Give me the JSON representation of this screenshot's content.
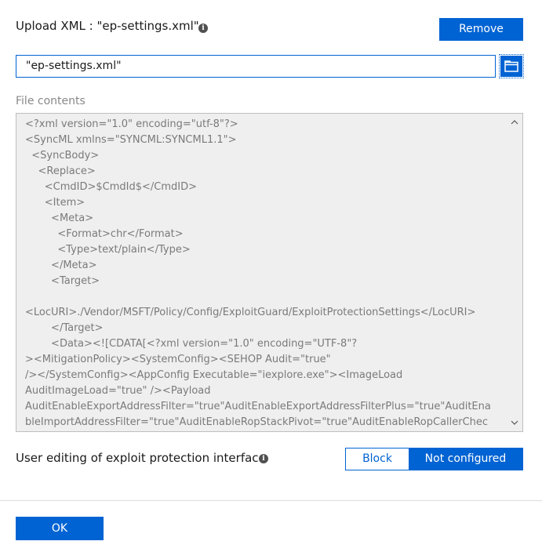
{
  "upload": {
    "label": "Upload XML : \"ep-settings.xml\"",
    "remove_label": "Remove",
    "file_value": "\"ep-settings.xml\""
  },
  "file_contents": {
    "label": "File contents",
    "text": "<?xml version=\"1.0\" encoding=\"utf-8\"?>\n<SyncML xmlns=\"SYNCML:SYNCML1.1\">\n  <SyncBody>\n    <Replace>\n      <CmdID>$CmdId$</CmdID>\n      <Item>\n        <Meta>\n          <Format>chr</Format>\n          <Type>text/plain</Type>\n        </Meta>\n        <Target>\n\n<LocURI>./Vendor/MSFT/Policy/Config/ExploitGuard/ExploitProtectionSettings</LocURI>\n        </Target>\n        <Data><![CDATA[<?xml version=\"1.0\" encoding=\"UTF-8\"?\n><MitigationPolicy><SystemConfig><SEHOP Audit=\"true\"\n/></SystemConfig><AppConfig Executable=\"iexplore.exe\"><ImageLoad\nAuditImageLoad=\"true\" /><Payload\nAuditEnableExportAddressFilter=\"true\"AuditEnableExportAddressFilterPlus=\"true\"AuditEna\nbleImportAddressFilter=\"true\"AuditEnableRopStackPivot=\"true\"AuditEnableRopCallerChec"
  },
  "editing": {
    "label": "User editing of exploit protection interface",
    "options": [
      "Block",
      "Not configured"
    ],
    "selected": "Not configured"
  },
  "footer": {
    "ok_label": "OK"
  },
  "colors": {
    "accent": "#0063d3"
  }
}
